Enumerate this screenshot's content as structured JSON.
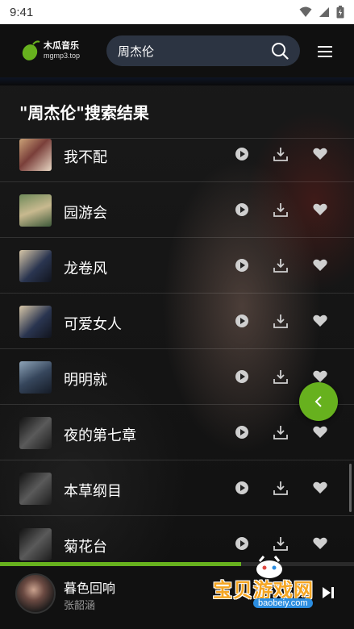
{
  "status_bar": {
    "time": "9:41",
    "icons": [
      "wifi-icon",
      "signal-icon",
      "battery-icon"
    ]
  },
  "header": {
    "logo_name": "木瓜音乐",
    "logo_domain": "mgmp3.top",
    "search_value": "周杰伦",
    "accent_color": "#67b11e"
  },
  "results": {
    "title": "\"周杰伦\"搜索结果",
    "songs": [
      {
        "title": "我不配"
      },
      {
        "title": "园游会"
      },
      {
        "title": "龙卷风"
      },
      {
        "title": "可爱女人"
      },
      {
        "title": "明明就"
      },
      {
        "title": "夜的第七章"
      },
      {
        "title": "本草纲目"
      },
      {
        "title": "菊花台"
      }
    ],
    "row_icons": [
      "play-icon",
      "download-icon",
      "heart-icon"
    ]
  },
  "player": {
    "title": "暮色回响",
    "artist": "张韶涵",
    "progress": 0.68
  },
  "watermark": {
    "text": "宝贝游戏网",
    "url": "baobeiy.com"
  }
}
